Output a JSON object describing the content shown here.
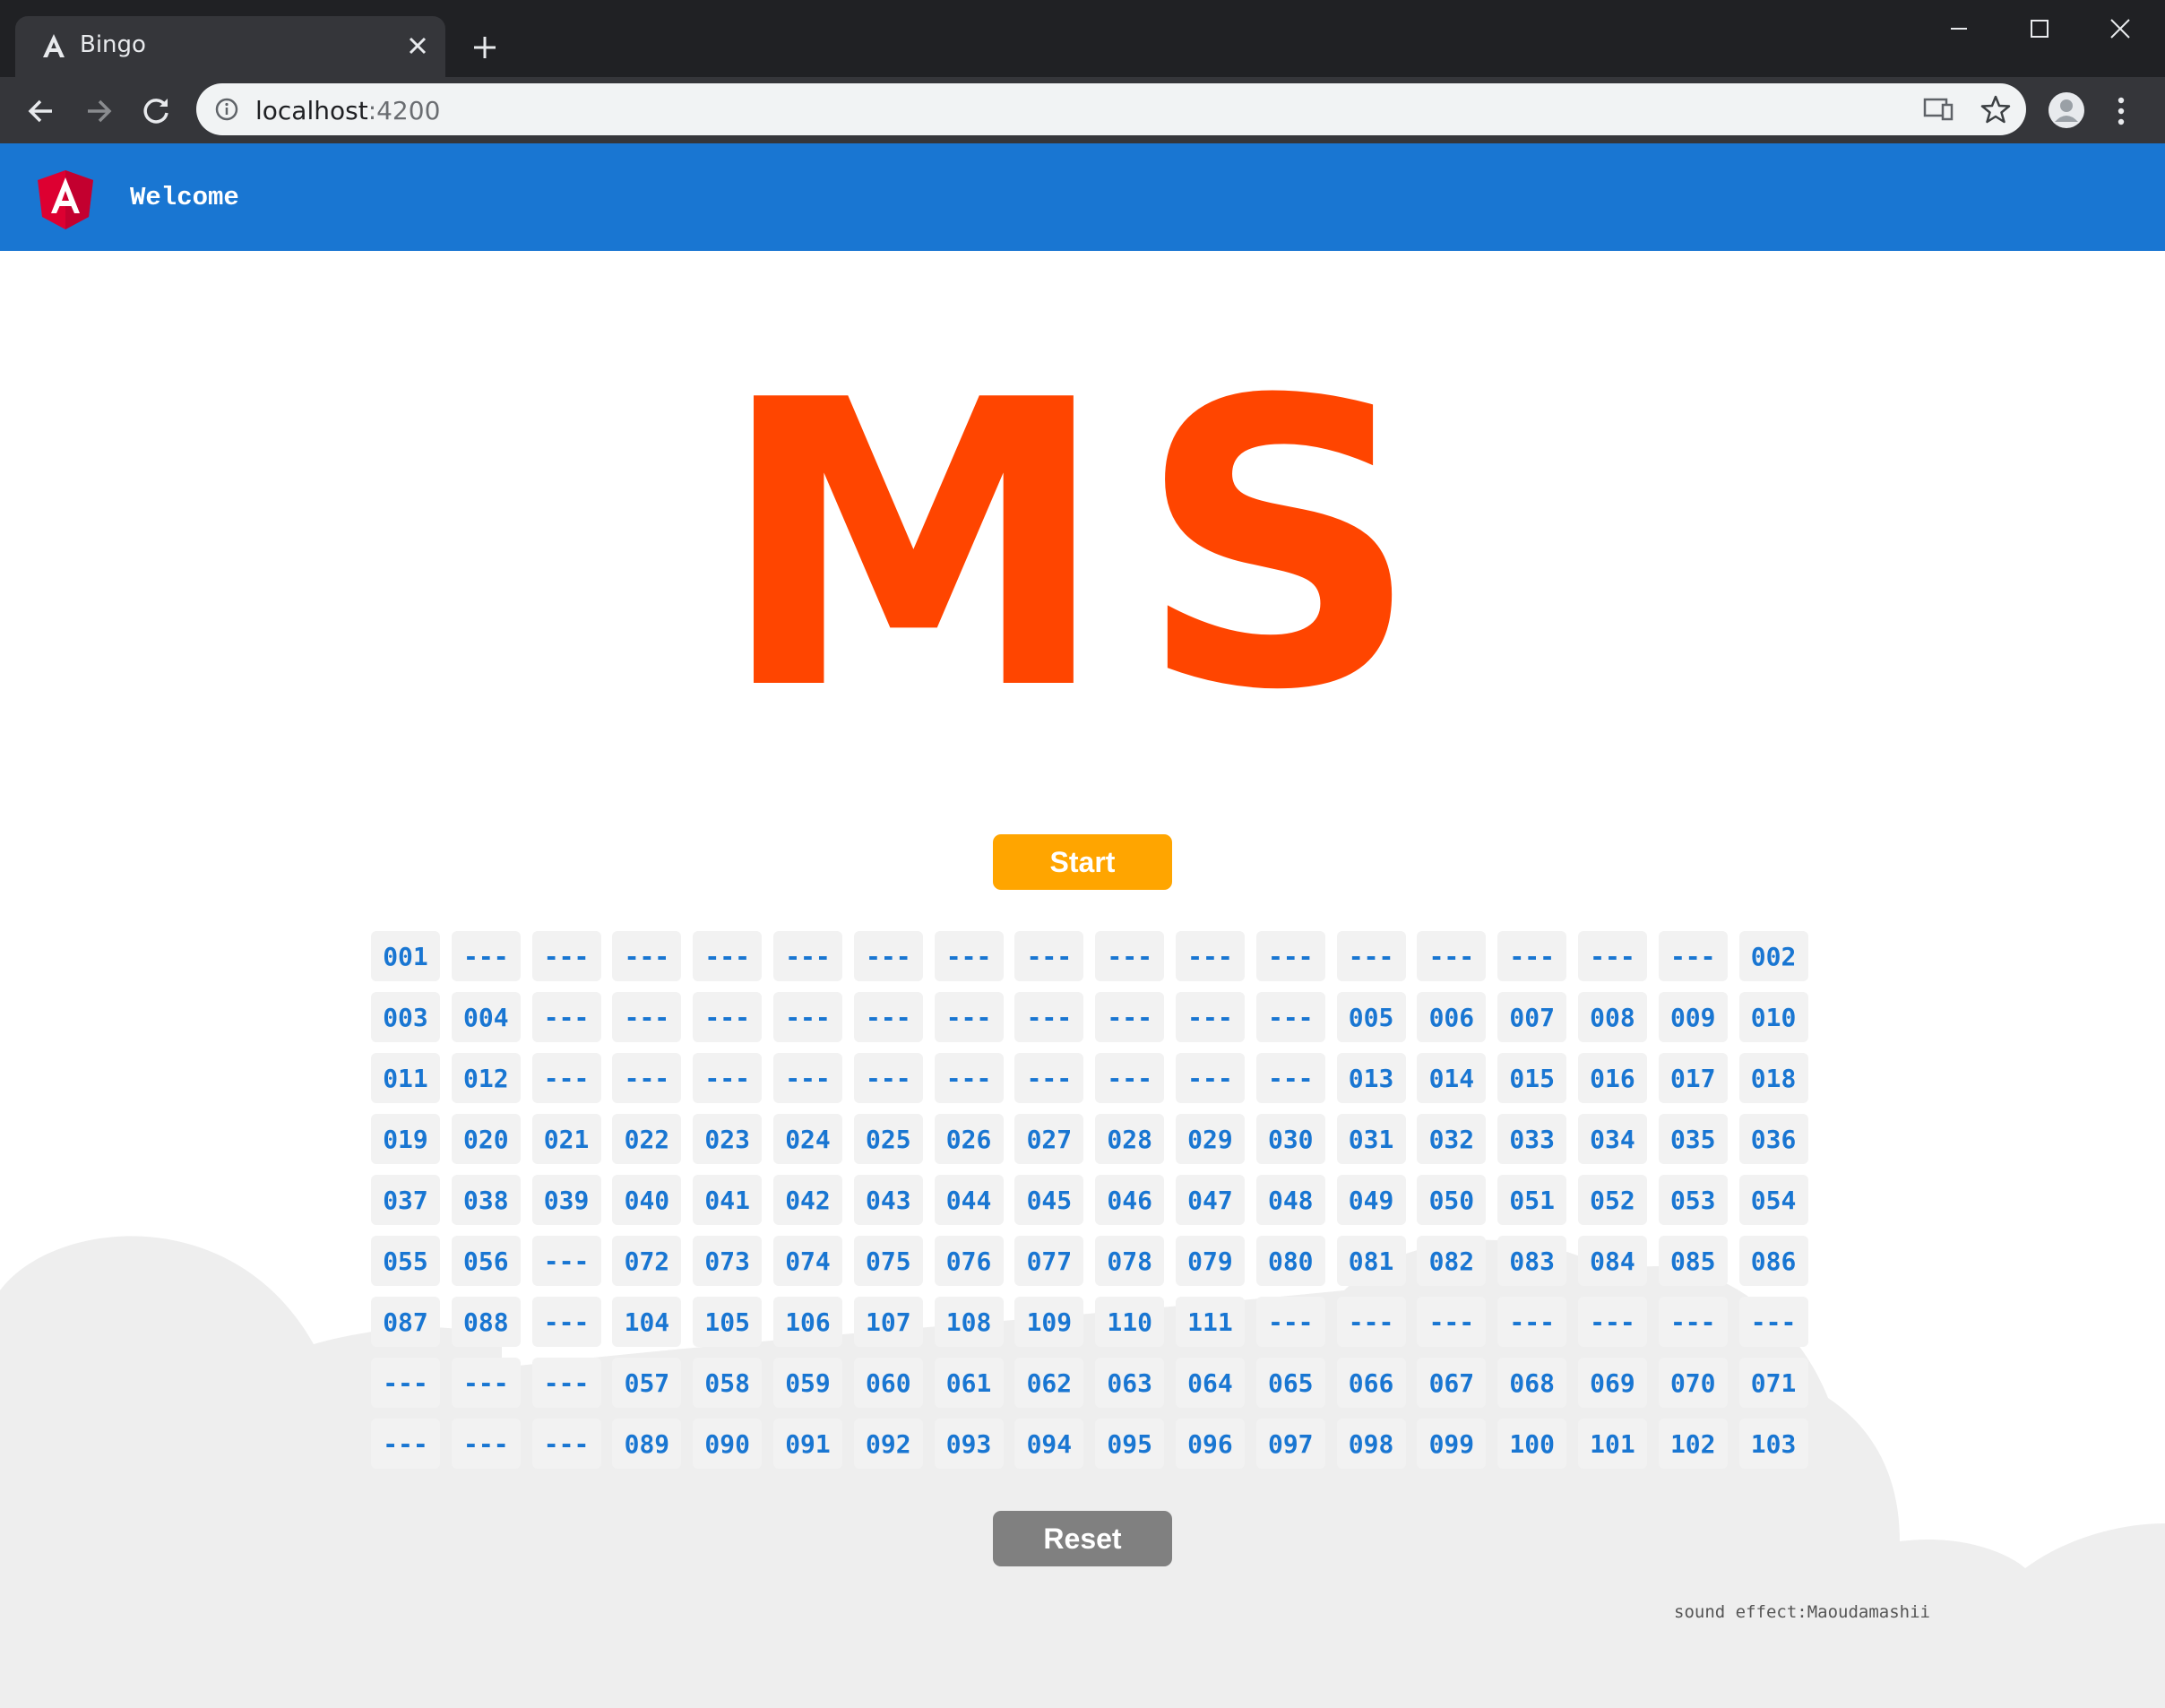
{
  "browser": {
    "tab_title": "Bingo",
    "url_host": "localhost",
    "url_port": ":4200"
  },
  "app": {
    "header_title": "Welcome",
    "current_draw": "MS",
    "start_label": "Start",
    "reset_label": "Reset",
    "credit": "sound effect:Maoudamashii",
    "colors": {
      "header": "#1976d2",
      "draw": "#ff4500",
      "start": "#ffa500",
      "reset": "#808080",
      "cell_text": "#1976d2"
    }
  },
  "board": [
    [
      "001",
      "---",
      "---",
      "---",
      "---",
      "---",
      "---",
      "---",
      "---",
      "---",
      "---",
      "---",
      "---",
      "---",
      "---",
      "---",
      "---",
      "002"
    ],
    [
      "003",
      "004",
      "---",
      "---",
      "---",
      "---",
      "---",
      "---",
      "---",
      "---",
      "---",
      "---",
      "005",
      "006",
      "007",
      "008",
      "009",
      "010"
    ],
    [
      "011",
      "012",
      "---",
      "---",
      "---",
      "---",
      "---",
      "---",
      "---",
      "---",
      "---",
      "---",
      "013",
      "014",
      "015",
      "016",
      "017",
      "018"
    ],
    [
      "019",
      "020",
      "021",
      "022",
      "023",
      "024",
      "025",
      "026",
      "027",
      "028",
      "029",
      "030",
      "031",
      "032",
      "033",
      "034",
      "035",
      "036"
    ],
    [
      "037",
      "038",
      "039",
      "040",
      "041",
      "042",
      "043",
      "044",
      "045",
      "046",
      "047",
      "048",
      "049",
      "050",
      "051",
      "052",
      "053",
      "054"
    ],
    [
      "055",
      "056",
      "---",
      "072",
      "073",
      "074",
      "075",
      "076",
      "077",
      "078",
      "079",
      "080",
      "081",
      "082",
      "083",
      "084",
      "085",
      "086"
    ],
    [
      "087",
      "088",
      "---",
      "104",
      "105",
      "106",
      "107",
      "108",
      "109",
      "110",
      "111",
      "---",
      "---",
      "---",
      "---",
      "---",
      "---",
      "---"
    ],
    [
      "---",
      "---",
      "---",
      "057",
      "058",
      "059",
      "060",
      "061",
      "062",
      "063",
      "064",
      "065",
      "066",
      "067",
      "068",
      "069",
      "070",
      "071"
    ],
    [
      "---",
      "---",
      "---",
      "089",
      "090",
      "091",
      "092",
      "093",
      "094",
      "095",
      "096",
      "097",
      "098",
      "099",
      "100",
      "101",
      "102",
      "103"
    ]
  ]
}
